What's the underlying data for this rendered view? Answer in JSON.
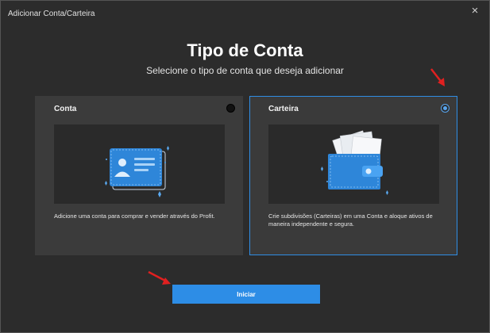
{
  "window": {
    "title": "Adicionar Conta/Carteira",
    "close_glyph": "×"
  },
  "header": {
    "title": "Tipo de Conta",
    "subtitle": "Selecione o tipo de conta que deseja adicionar"
  },
  "options": [
    {
      "title": "Conta",
      "description": "Adicione uma conta para comprar e vender através do Profit.",
      "selected": false,
      "icon": "id-card-icon"
    },
    {
      "title": "Carteira",
      "description": "Crie subdivisões (Carteiras) em uma Conta e aloque ativos de maneira independente e segura.",
      "selected": true,
      "icon": "wallet-icon"
    }
  ],
  "actions": {
    "start_label": "Iniciar"
  },
  "colors": {
    "accent": "#2d8de6",
    "annotation_arrow": "#e02020",
    "background": "#2c2c2c",
    "card": "#3b3b3b"
  }
}
